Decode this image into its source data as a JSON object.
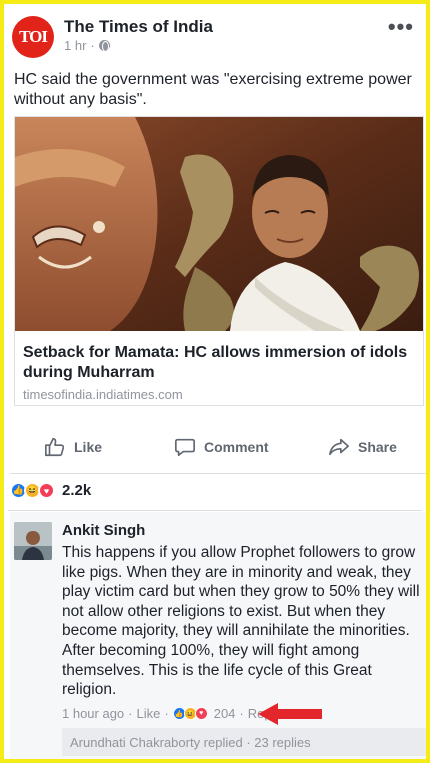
{
  "post": {
    "page_name": "The Times of India",
    "logo_text": "TOI",
    "time": "1 hr",
    "more_icon": "more-icon",
    "text": "HC said the government was \"exercising extreme power without any basis\"."
  },
  "link_card": {
    "title": "Setback for Mamata: HC allows immersion of idols during Muharram",
    "domain": "timesofindia.indiatimes.com"
  },
  "actions": {
    "like": "Like",
    "comment": "Comment",
    "share": "Share"
  },
  "reactions": {
    "count": "2.2k",
    "types": [
      "like",
      "haha",
      "love"
    ]
  },
  "comment": {
    "author": "Ankit Singh",
    "text": "This happens if you allow Prophet followers to grow like pigs. When they are in minority and weak, they play victim card but when they grow to 50% they will not allow other religions to exist. But when they become majority, they will annihilate the minorities. After becoming 100%, they will fight among themselves. This is the life cycle of this Great religion.",
    "time": "1 hour ago",
    "like_label": "Like",
    "reaction_count": "204",
    "reply_label": "Reply",
    "replies_summary": "Arundhati Chakraborty replied · 23 replies"
  },
  "colors": {
    "frame": "#f5ec17",
    "like_blue": "#1877f2",
    "haha_yellow": "#f7b125",
    "love_red": "#f33e58",
    "arrow_red": "#e3262b",
    "logo_red": "#e2231a"
  }
}
